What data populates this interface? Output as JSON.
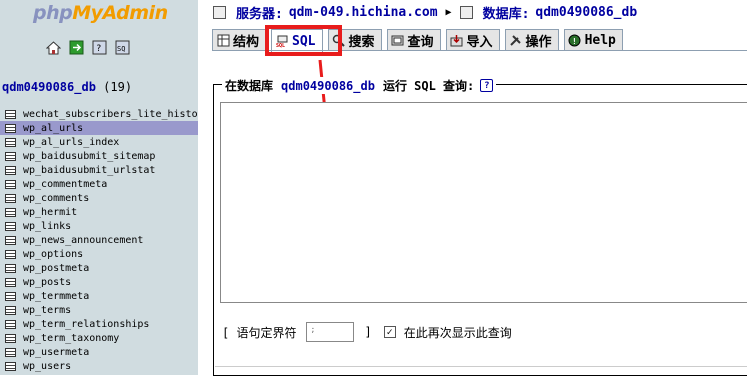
{
  "logo": {
    "part1": "php",
    "part2": "My",
    "part3": "Admin"
  },
  "sidebar": {
    "db_name": "qdm0490086_db",
    "db_count": "(19)",
    "icons": [
      "home-icon",
      "exit-icon",
      "query-window-icon",
      "sql-docs-icon"
    ],
    "tables": [
      "wechat_subscribers_lite_histo",
      "wp_al_urls",
      "wp_al_urls_index",
      "wp_baidusubmit_sitemap",
      "wp_baidusubmit_urlstat",
      "wp_commentmeta",
      "wp_comments",
      "wp_hermit",
      "wp_links",
      "wp_news_announcement",
      "wp_options",
      "wp_postmeta",
      "wp_posts",
      "wp_termmeta",
      "wp_terms",
      "wp_term_relationships",
      "wp_term_taxonomy",
      "wp_usermeta",
      "wp_users"
    ],
    "selected": "wp_al_urls"
  },
  "breadcrumb": {
    "server_label": "服务器:",
    "server_value": "qdm-049.hichina.com",
    "db_label": "数据库:",
    "db_value": "qdm0490086_db"
  },
  "tabs": [
    {
      "label": "结构",
      "icon": "structure-icon"
    },
    {
      "label": "SQL",
      "icon": "sql-icon",
      "active": true
    },
    {
      "label": "搜索",
      "icon": "search-icon"
    },
    {
      "label": "查询",
      "icon": "query-icon"
    },
    {
      "label": "导入",
      "icon": "import-icon"
    },
    {
      "label": "操作",
      "icon": "operations-icon"
    },
    {
      "label": "Help",
      "icon": "help-icon"
    }
  ],
  "query": {
    "legend_prefix": "在数据库",
    "legend_db": "qdm0490086_db",
    "legend_suffix": "运行 SQL 查询:",
    "sql_text": "",
    "delimiter_label": "[ 语句定界符",
    "delimiter_value": ";",
    "delimiter_close": "]",
    "show_again_label": "在此再次显示此查询",
    "show_again_checked": true
  },
  "colors": {
    "sidebar_bg": "#d0dce0",
    "link": "#0000a0",
    "selected_row": "#9999cc",
    "highlight": "#e81c1c"
  }
}
